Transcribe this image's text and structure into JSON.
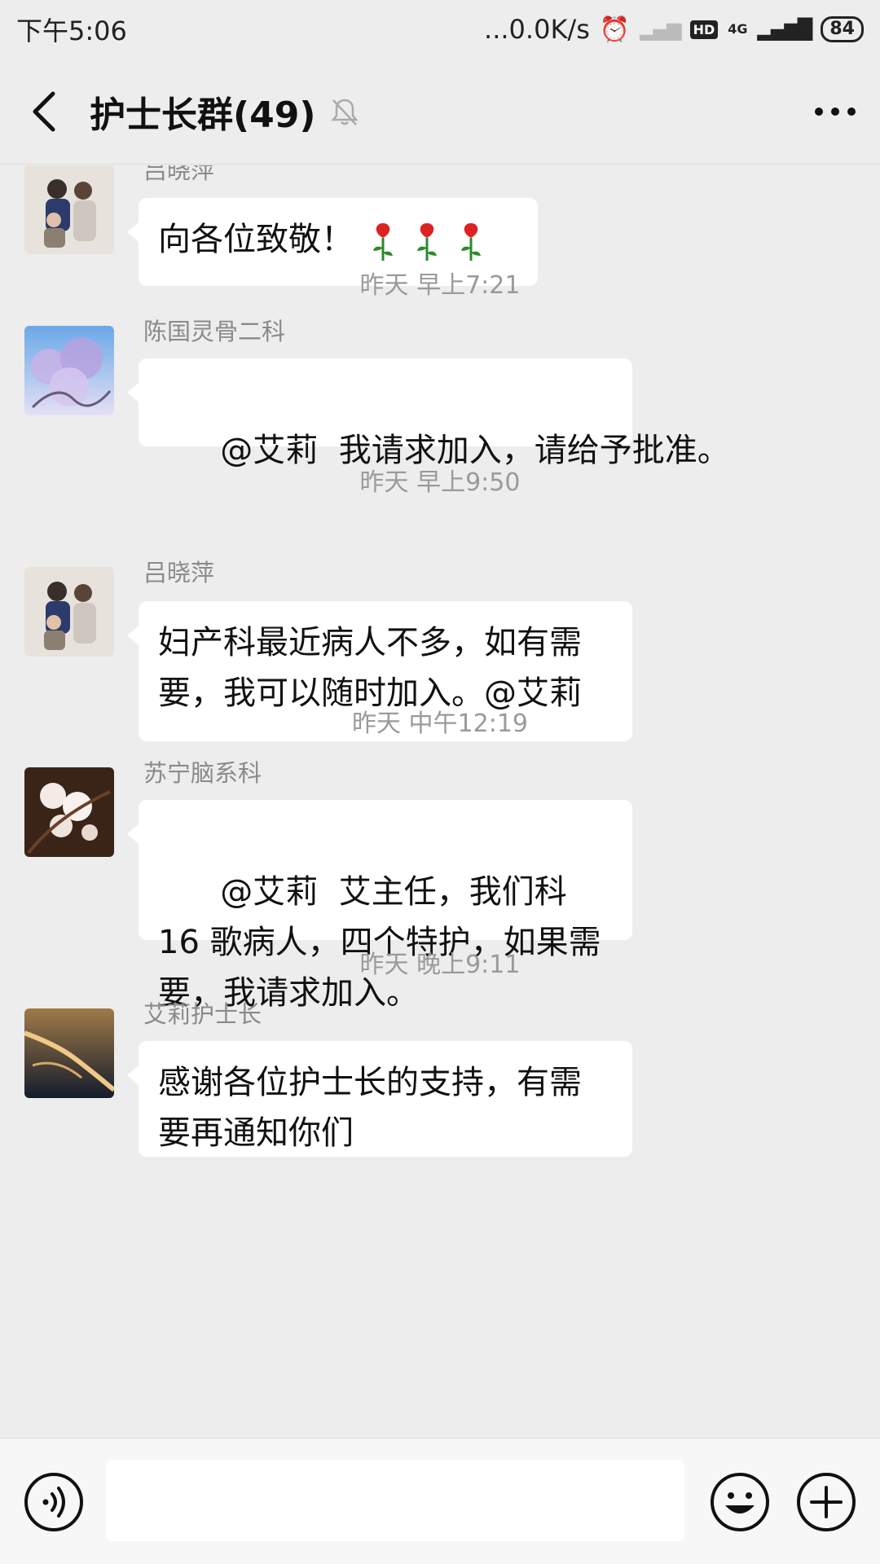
{
  "status_bar": {
    "time": "下午5:06",
    "net_speed": "...0.0K/s",
    "hd": "HD",
    "network": "4G",
    "battery": "84"
  },
  "header": {
    "title": "护士长群(49)"
  },
  "messages": [
    {
      "sender": "吕晓萍",
      "text": "向各位致敬！",
      "avatar": "family-photo",
      "emoji": [
        "rose",
        "rose",
        "rose"
      ]
    },
    {
      "sender": "陈国灵骨二科",
      "text": "@艾莉  我请求加入，请给予批准。",
      "avatar": "blossom-photo"
    },
    {
      "sender": "吕晓萍",
      "text": "妇产科最近病人不多，如有需要，我可以随时加入。@艾莉",
      "avatar": "family-photo"
    },
    {
      "sender": "苏宁脑系科",
      "text": "@艾莉  艾主任，我们科 16 歌病人，四个特护，如果需要，我请求加入。",
      "avatar": "flower-photo"
    },
    {
      "sender": "艾莉护士长",
      "text": "感谢各位护士长的支持，有需要再通知你们",
      "avatar": "desert-photo"
    }
  ],
  "timestamps": [
    "昨天 早上7:21",
    "昨天 早上9:50",
    "昨天 中午12:19",
    "昨天 晚上9:11"
  ],
  "colors": {
    "background": "#ededed",
    "bubble": "#ffffff",
    "meta_text": "#9a9a9a"
  },
  "input_bar": {
    "icons": [
      "voice-icon",
      "emoji-icon",
      "plus-icon"
    ]
  }
}
